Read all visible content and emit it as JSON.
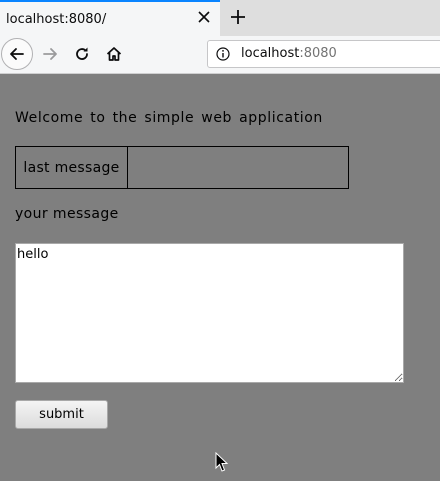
{
  "browser": {
    "tab_title": "localhost:8080/",
    "url_host": "localhost",
    "url_port": ":8080"
  },
  "page": {
    "welcome_text": "Welcome to the simple web application",
    "last_message_label": "last message",
    "last_message_value": "",
    "your_message_label": "your message",
    "message_input_value": "hello",
    "submit_label": "submit"
  }
}
